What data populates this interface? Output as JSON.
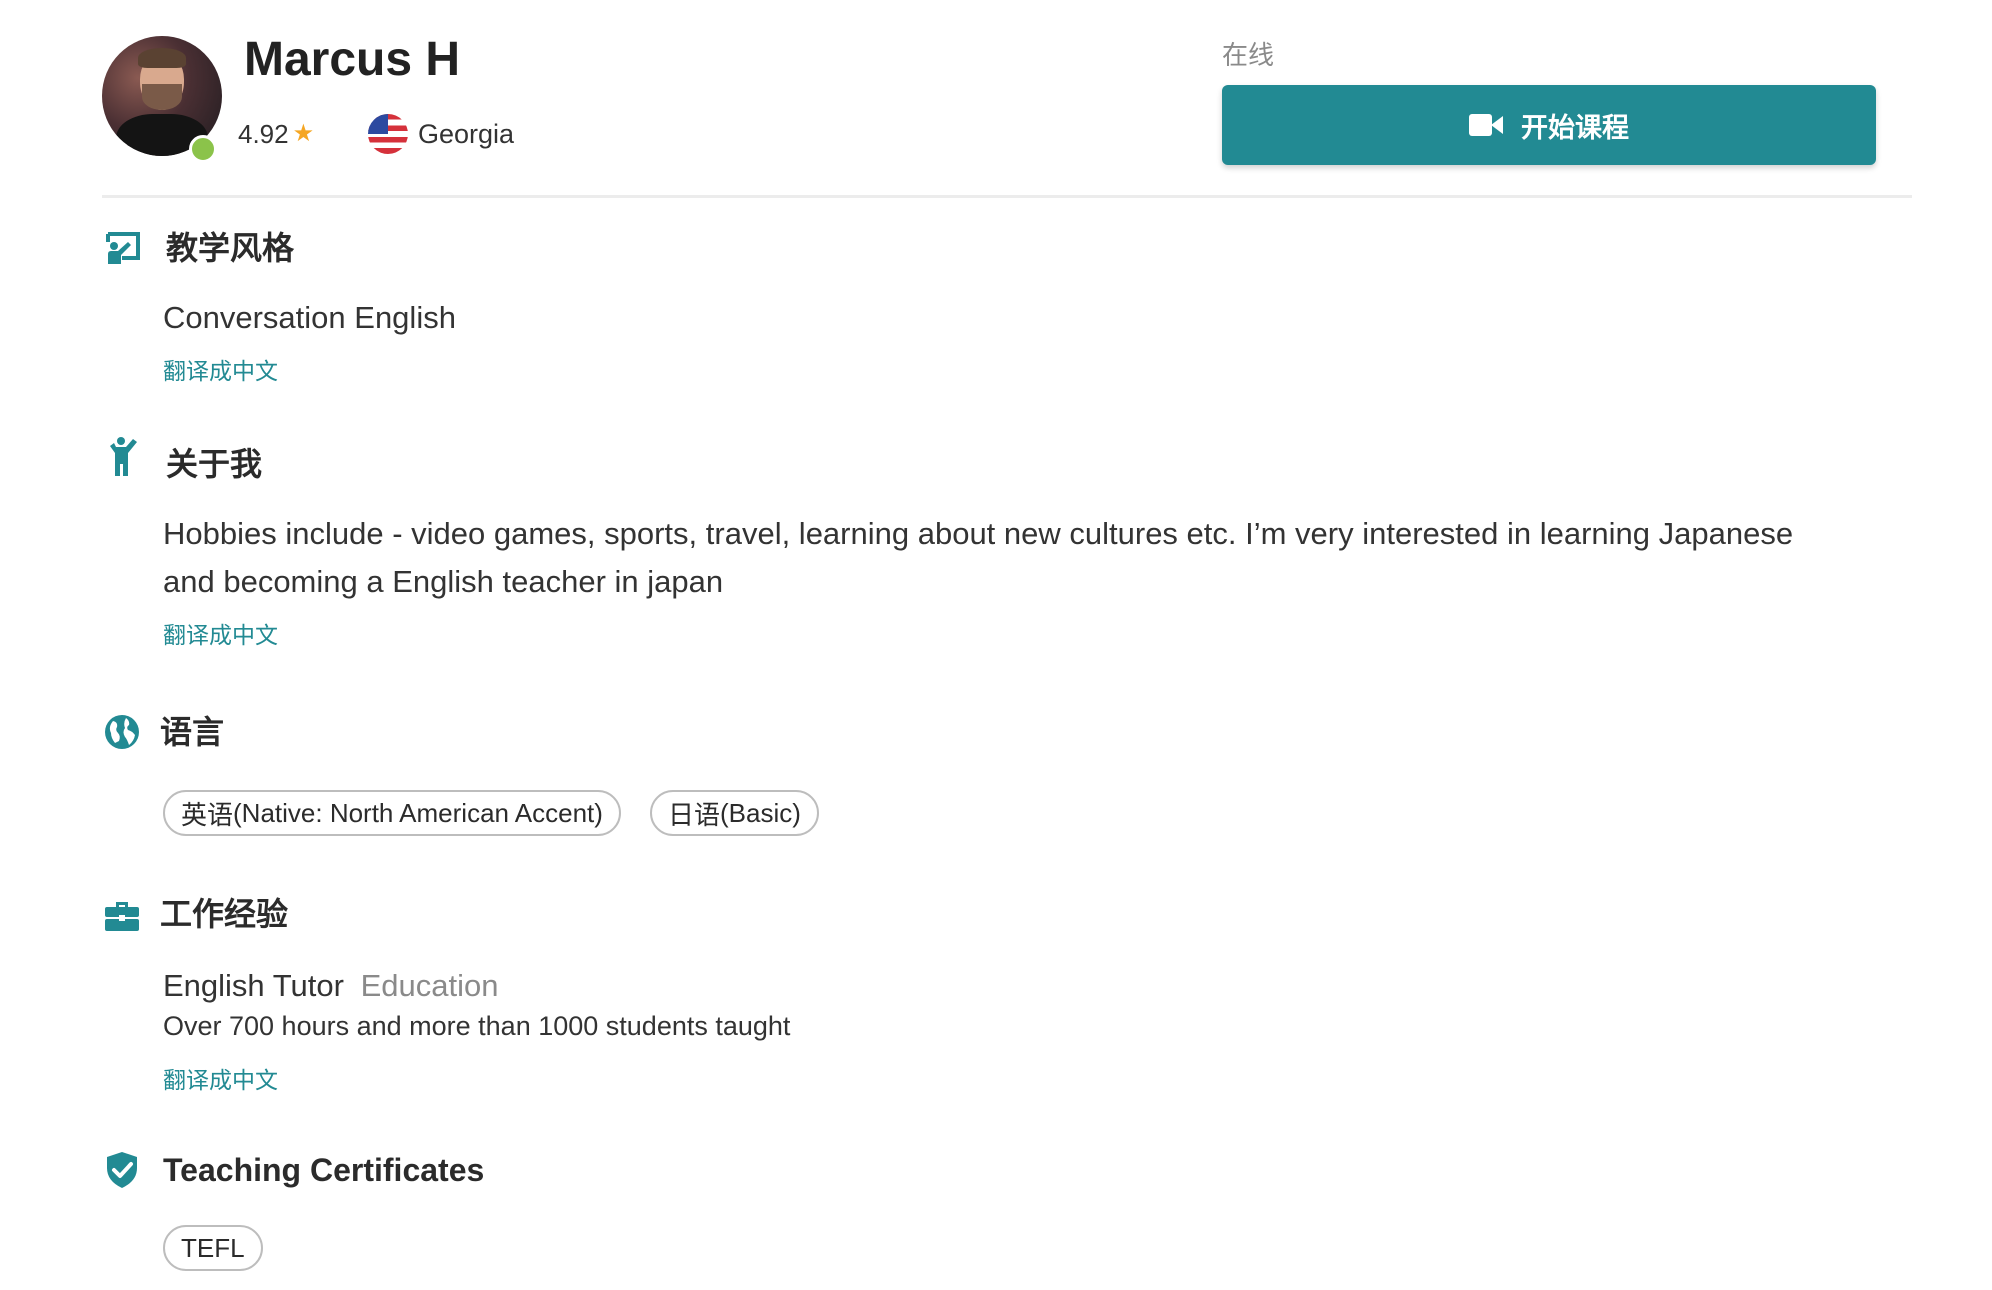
{
  "profile": {
    "name": "Marcus H",
    "rating": "4.92",
    "location": "Georgia",
    "status": "在线",
    "start_button_label": "开始课程"
  },
  "sections": {
    "teaching_style": {
      "title": "教学风格",
      "text": "Conversation English",
      "translate_label": "翻译成中文"
    },
    "about_me": {
      "title": "关于我",
      "text_line1": "Hobbies include - video games, sports, travel, learning about new cultures etc. I’m very interested in learning Japanese",
      "text_line2": "and becoming a English teacher in japan",
      "translate_label": "翻译成中文"
    },
    "languages": {
      "title": "语言",
      "items": [
        {
          "lang": "英语",
          "level": " (Native: North American Accent)"
        },
        {
          "lang": "日语",
          "level": " (Basic)"
        }
      ]
    },
    "work_experience": {
      "title": "工作经验",
      "role": "English Tutor",
      "field": "Education",
      "description": "Over 700 hours and more than 1000 students taught",
      "translate_label": "翻译成中文"
    },
    "certificates": {
      "title": "Teaching Certificates",
      "items": [
        "TEFL"
      ]
    }
  },
  "colors": {
    "accent": "#228a93",
    "online": "#8bc34a",
    "star": "#f5a623",
    "muted": "#8a8a8a"
  },
  "icons": {
    "teaching_style": "teaching-icon",
    "about_me": "person-waving-icon",
    "languages": "globe-icon",
    "work_experience": "briefcase-icon",
    "certificates": "shield-check-icon",
    "video": "video-camera-icon",
    "star": "star-icon",
    "flag": "us-flag-icon"
  }
}
